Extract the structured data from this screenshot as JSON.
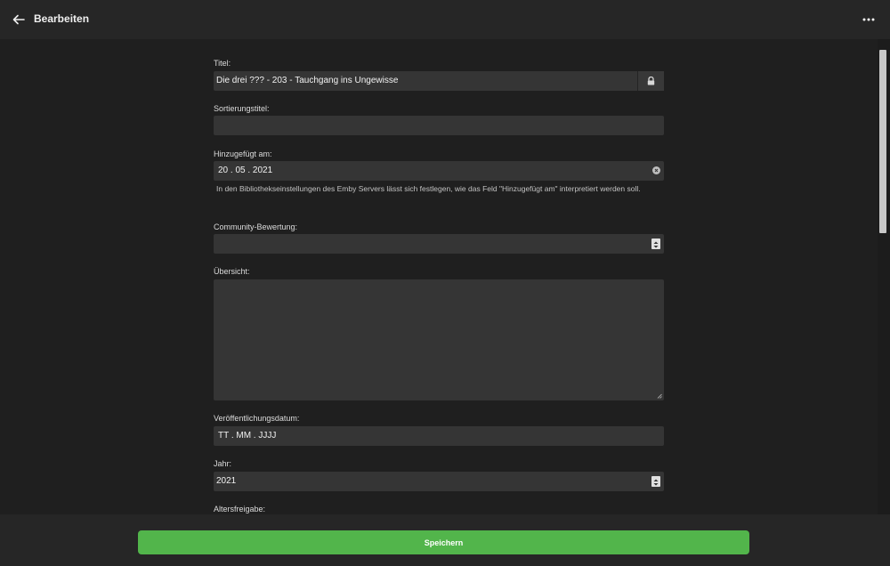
{
  "header": {
    "title": "Bearbeiten"
  },
  "form": {
    "title": {
      "label": "Titel:",
      "value": "Die drei ??? - 203 - Tauchgang ins Ungewisse"
    },
    "sort_title": {
      "label": "Sortierungstitel:",
      "value": ""
    },
    "date_added": {
      "label": "Hinzugefügt am:",
      "value": "20 . 05 . 2021",
      "help": "In den Bibliothekseinstellungen des Emby Servers lässt sich festlegen, wie das Feld \"Hinzugefügt am\" interpretiert werden soll."
    },
    "community_rating": {
      "label": "Community-Bewertung:",
      "value": ""
    },
    "overview": {
      "label": "Übersicht:",
      "value": ""
    },
    "release_date": {
      "label": "Veröffentlichungsdatum:",
      "placeholder": "TT . MM . JJJJ"
    },
    "year": {
      "label": "Jahr:",
      "value": "2021"
    },
    "age_rating": {
      "label": "Altersfreigabe:"
    }
  },
  "footer": {
    "save_label": "Speichern"
  },
  "colors": {
    "accent": "#52b54b",
    "background": "#1f1f1f",
    "field": "#353535"
  },
  "icons": {
    "back": "arrow-left-icon",
    "more": "more-horizontal-icon",
    "lock": "lock-icon",
    "clear": "clear-icon",
    "spinner": "spinner-icon"
  }
}
